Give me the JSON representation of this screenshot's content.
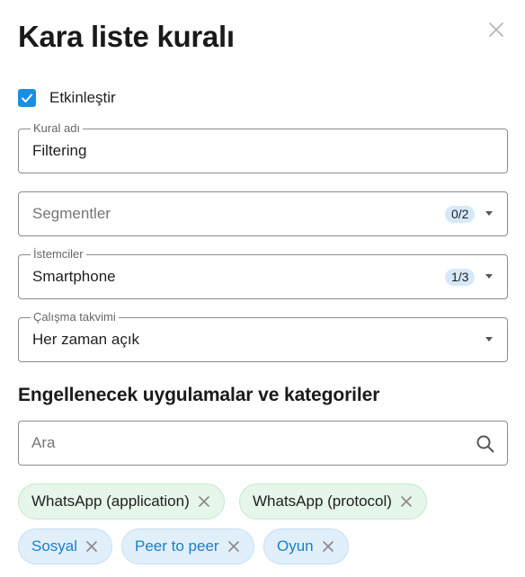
{
  "dialog": {
    "title": "Kara liste kuralı"
  },
  "enable": {
    "label": "Etkinleştir",
    "checked": true
  },
  "rule_name": {
    "legend": "Kural adı",
    "value": "Filtering"
  },
  "segments": {
    "placeholder": "Segmentler",
    "count": "0/2"
  },
  "clients": {
    "legend": "İstemciler",
    "value": "Smartphone",
    "count": "1/3"
  },
  "schedule": {
    "legend": "Çalışma takvimi",
    "value": "Her zaman açık"
  },
  "blocked": {
    "title": "Engellenecek uygulamalar ve kategoriler",
    "search_placeholder": "Ara",
    "apps": [
      "WhatsApp (application)",
      "WhatsApp (protocol)"
    ],
    "categories": [
      "Sosyal",
      "Peer to peer",
      "Oyun"
    ]
  },
  "colors": {
    "accent": "#1a8fe0",
    "app_chip_bg": "#e6f6ea",
    "category_chip_bg": "#e1effb",
    "category_text": "#1a7fc9"
  }
}
